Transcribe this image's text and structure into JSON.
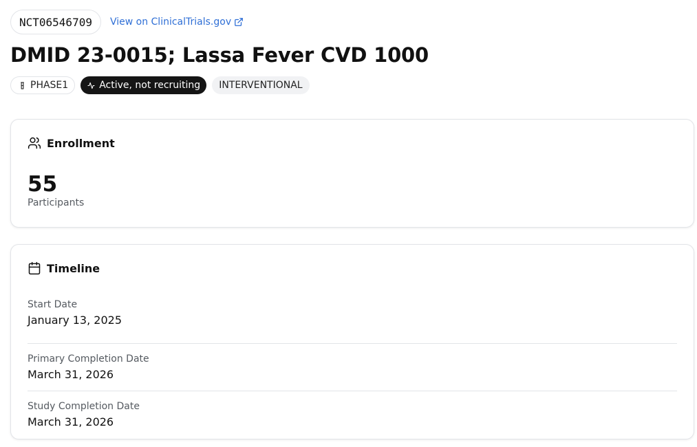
{
  "header": {
    "nct_id": "NCT06546709",
    "external_link_label": "View on ClinicalTrials.gov",
    "title": "DMID 23-0015; Lassa Fever CVD 1000"
  },
  "badges": {
    "phase": "PHASE1",
    "status": "Active, not recruiting",
    "study_type": "INTERVENTIONAL"
  },
  "enrollment": {
    "heading": "Enrollment",
    "count": "55",
    "unit_label": "Participants"
  },
  "timeline": {
    "heading": "Timeline",
    "items": [
      {
        "label": "Start Date",
        "value": "January 13, 2025"
      },
      {
        "label": "Primary Completion Date",
        "value": "March 31, 2026"
      },
      {
        "label": "Study Completion Date",
        "value": "March 31, 2026"
      }
    ]
  },
  "colors": {
    "link": "#2f6fd6",
    "status_badge_bg": "#151515",
    "type_badge_bg": "#f1f2f4",
    "border": "#e2e4e8"
  },
  "icons": {
    "external_link": "external-link-icon",
    "phase": "flask-icon",
    "status": "activity-icon",
    "enrollment": "users-icon",
    "timeline": "calendar-icon"
  }
}
